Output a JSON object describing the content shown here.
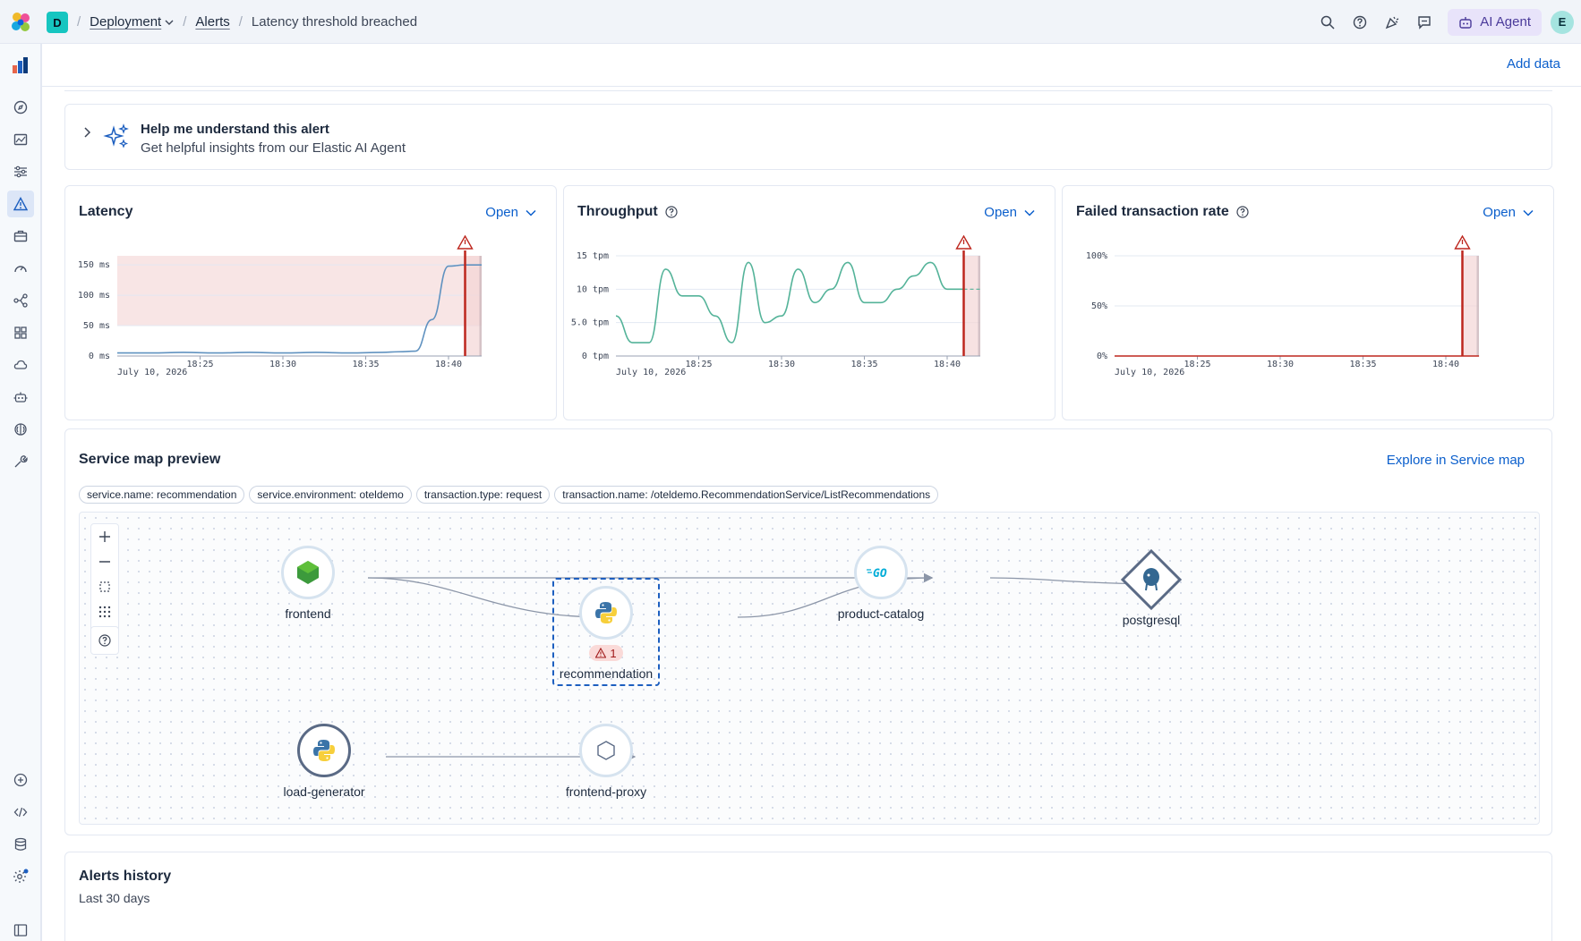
{
  "topbar": {
    "deployment_badge": "D",
    "breadcrumb_deployment": "Deployment",
    "breadcrumb_alerts": "Alerts",
    "breadcrumb_current": "Latency threshold breached",
    "ai_agent_label": "AI Agent",
    "avatar_initial": "E"
  },
  "header": {
    "add_data_label": "Add data"
  },
  "ai_insight": {
    "title": "Help me understand this alert",
    "subtitle": "Get helpful insights from our Elastic AI Agent"
  },
  "cards": {
    "latency": {
      "title": "Latency",
      "open_label": "Open"
    },
    "throughput": {
      "title": "Throughput",
      "open_label": "Open"
    },
    "failed": {
      "title": "Failed transaction rate",
      "open_label": "Open"
    }
  },
  "chart_data": [
    {
      "type": "line",
      "title": "Latency",
      "y_tick_labels": [
        "0 ms",
        "50 ms",
        "100 ms",
        "150 ms"
      ],
      "ylim": [
        0,
        165
      ],
      "x_tick_labels": [
        "18:25",
        "18:30",
        "18:35",
        "18:40"
      ],
      "date_label": "July 10, 2026",
      "threshold": 50,
      "series": [
        {
          "x": [
            "18:20",
            "18:22",
            "18:24",
            "18:26",
            "18:28",
            "18:30",
            "18:32",
            "18:34",
            "18:36",
            "18:37",
            "18:38",
            "18:39",
            "18:40",
            "18:41",
            "18:42"
          ],
          "values": [
            5,
            5,
            6,
            5,
            6,
            5,
            6,
            5,
            6,
            7,
            8,
            60,
            148,
            150,
            150
          ]
        }
      ],
      "alert_time": "18:41"
    },
    {
      "type": "line",
      "title": "Throughput",
      "y_tick_labels": [
        "0 tpm",
        "5.0 tpm",
        "10 tpm",
        "15 tpm"
      ],
      "ylim": [
        0,
        15
      ],
      "x_tick_labels": [
        "18:25",
        "18:30",
        "18:35",
        "18:40"
      ],
      "date_label": "July 10, 2026",
      "series": [
        {
          "x": [
            "18:20",
            "18:21",
            "18:22",
            "18:23",
            "18:24",
            "18:25",
            "18:26",
            "18:27",
            "18:28",
            "18:29",
            "18:30",
            "18:31",
            "18:32",
            "18:33",
            "18:34",
            "18:35",
            "18:36",
            "18:37",
            "18:38",
            "18:39",
            "18:40",
            "18:41"
          ],
          "values": [
            6,
            2,
            2,
            13,
            9,
            9,
            6,
            2,
            14,
            5,
            6,
            13,
            8,
            10,
            14,
            8,
            8,
            10,
            12,
            14,
            10,
            10
          ]
        }
      ],
      "alert_time": "18:41"
    },
    {
      "type": "line",
      "title": "Failed transaction rate",
      "y_tick_labels": [
        "0%",
        "50%",
        "100%"
      ],
      "ylim": [
        0,
        100
      ],
      "x_tick_labels": [
        "18:25",
        "18:30",
        "18:35",
        "18:40"
      ],
      "date_label": "July 10, 2026",
      "series": [
        {
          "x": [
            "18:20",
            "18:42"
          ],
          "values": [
            0,
            0
          ]
        }
      ],
      "alert_time": "18:41"
    }
  ],
  "service_map": {
    "title": "Service map preview",
    "explore_label": "Explore in Service map",
    "filters": [
      "service.name: recommendation",
      "service.environment: oteldemo",
      "transaction.type: request",
      "transaction.name: /oteldemo.RecommendationService/ListRecommendations"
    ],
    "nodes": {
      "frontend": "frontend",
      "recommendation": "recommendation",
      "recommendation_alerts": "1",
      "product_catalog": "product-catalog",
      "postgresql": "postgresql",
      "load_generator": "load-generator",
      "frontend_proxy": "frontend-proxy"
    }
  },
  "alerts_history": {
    "title": "Alerts history",
    "subtitle": "Last 30 days"
  },
  "colors": {
    "accent": "#0b5fcc",
    "alert_red": "#bd271e",
    "threshold_fill": "#f6dede",
    "series_blue": "#6092c0",
    "series_teal": "#54b399"
  }
}
